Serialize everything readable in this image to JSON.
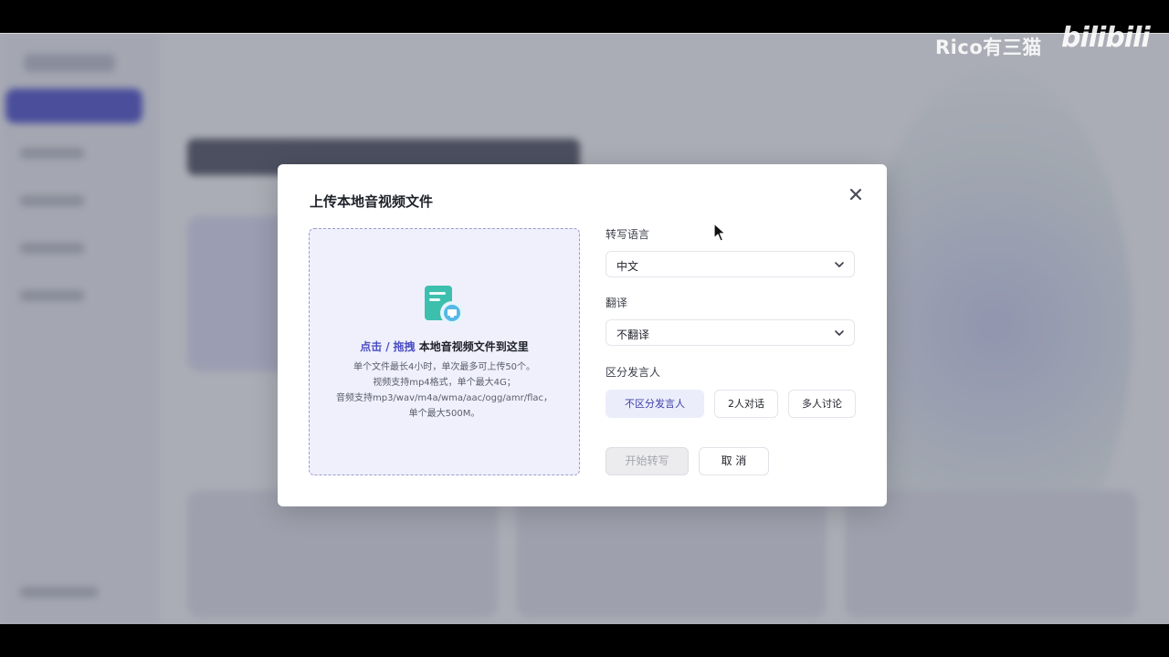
{
  "watermark": {
    "channel": "Rico有三猫",
    "logo_text": "bilibili"
  },
  "modal": {
    "title": "上传本地音视频文件",
    "upload": {
      "click_link": "点击",
      "separator": "/",
      "drag_link": "拖拽",
      "main_text": "本地音视频文件到这里",
      "hints": [
        "单个文件最长4小时，单次最多可上传50个。",
        "视频支持mp4格式，单个最大4G；",
        "音频支持mp3/wav/m4a/wma/aac/ogg/amr/flac，",
        "单个最大500M。"
      ]
    },
    "transcribe_language": {
      "label": "转写语言",
      "value": "中文"
    },
    "translate": {
      "label": "翻译",
      "value": "不翻译"
    },
    "speakers": {
      "label": "区分发言人",
      "options": [
        "不区分发言人",
        "2人对话",
        "多人讨论"
      ],
      "selected": "不区分发言人"
    },
    "buttons": {
      "start": "开始转写",
      "cancel": "取 消"
    }
  },
  "colors": {
    "accent": "#4a4fc4",
    "dropzone_bg": "#f0f0fc",
    "selected_segment_bg": "#ecedfb"
  },
  "icons": {
    "close": "close-icon",
    "upload_file": "file-upload-icon",
    "dropdown": "chevron-down-icon"
  }
}
